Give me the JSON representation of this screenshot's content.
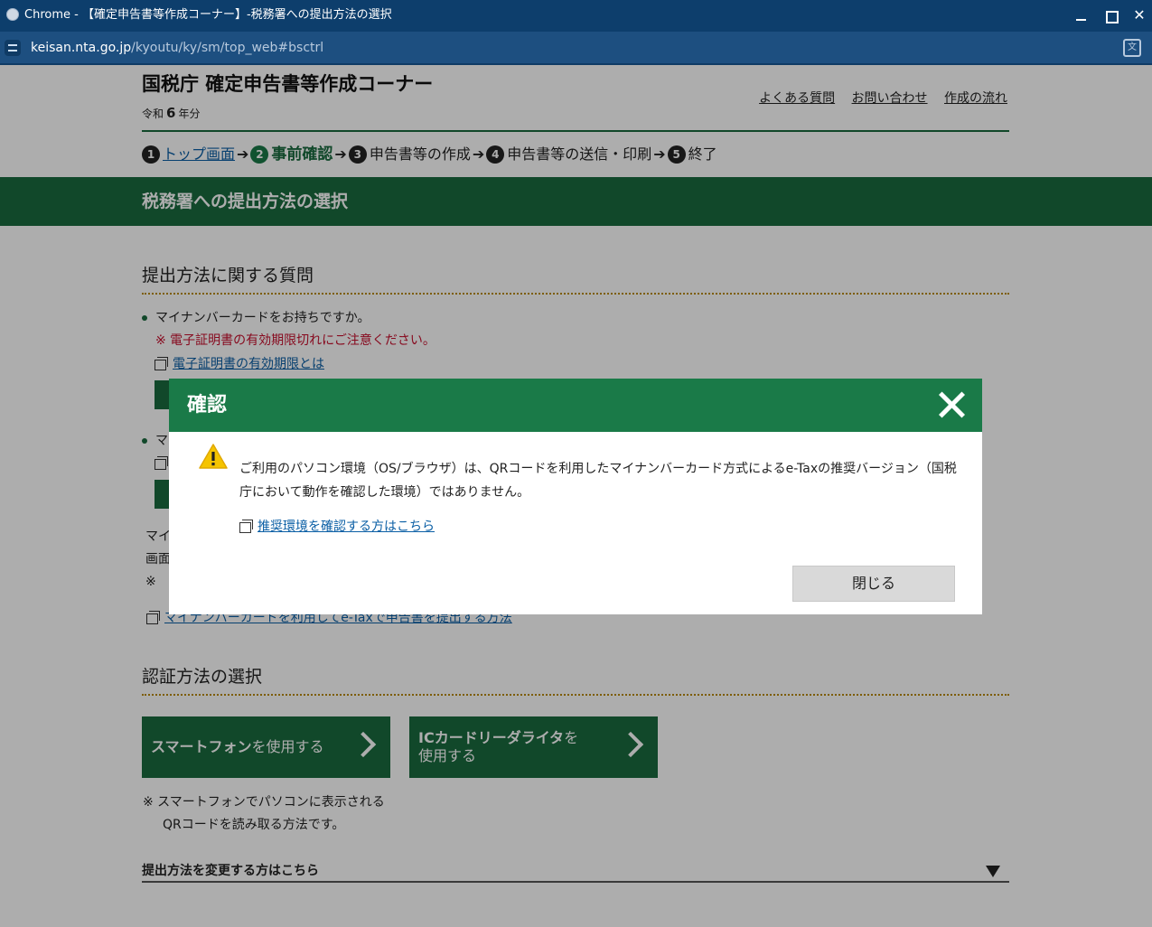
{
  "browser": {
    "window_title": "Chrome - 【確定申告書等作成コーナー】-税務署への提出方法の選択",
    "url_host": "keisan.nta.go.jp",
    "url_path": "/kyoutu/ky/sm/top_web#bsctrl"
  },
  "header": {
    "site_title": "国税庁 確定申告書等作成コーナー",
    "era_prefix": "令和",
    "era_year": "6",
    "era_suffix": "年分",
    "links": [
      "よくある質問",
      "お問い合わせ",
      "作成の流れ"
    ]
  },
  "steps": [
    {
      "num": "1",
      "label": "トップ画面"
    },
    {
      "num": "2",
      "label": "事前確認"
    },
    {
      "num": "3",
      "label": "申告書等の作成"
    },
    {
      "num": "4",
      "label": "申告書等の送信・印刷"
    },
    {
      "num": "5",
      "label": "終了"
    }
  ],
  "arrow": "➔",
  "banner_title": "税務署への提出方法の選択",
  "section1": {
    "heading": "提出方法に関する質問",
    "question1": "マイナンバーカードをお持ちですか。",
    "warning": "※ 電子証明書の有効期限切れにご注意ください。",
    "link1": "電子証明書の有効期限とは",
    "question2_partial": "マ",
    "plain_line1": "マイ",
    "plain_line2": "画面",
    "plain_note": "※",
    "link_etax": "マイナンバーカードを利用してe-Taxで申告書を提出する方法"
  },
  "section2": {
    "heading": "認証方法の選択",
    "btn_phone_bold": "スマートフォン",
    "btn_phone_rest": "を使用する",
    "btn_ic_bold": "ICカードリーダライタ",
    "btn_ic_rest1": "を",
    "btn_ic_rest2": "使用する",
    "note_line1": "※ スマートフォンでパソコンに表示される",
    "note_line2": "QRコードを読み取る方法です。",
    "collapse_label": "提出方法を変更する方はこちら"
  },
  "modal": {
    "title": "確認",
    "message": "ご利用のパソコン環境（OS/ブラウザ）は、QRコードを利用したマイナンバーカード方式によるe-Taxの推奨バージョン（国税庁において動作を確認した環境）ではありません。",
    "link": "推奨環境を確認する方はこちら",
    "close_button": "閉じる"
  },
  "colors": {
    "brand_green": "#1a6b3f",
    "modal_header_green": "#1a7a48",
    "warning_red": "#c8102e",
    "link_blue": "#0b5fa5",
    "chrome_titlebar": "#0d3e6c"
  }
}
